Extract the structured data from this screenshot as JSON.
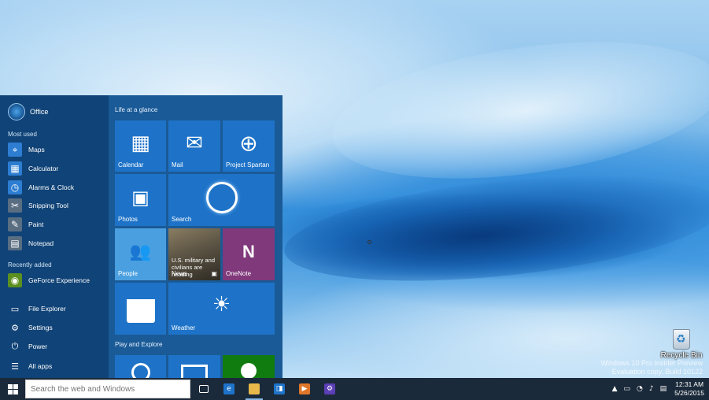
{
  "desktop": {
    "recycle_bin_label": "Recycle Bin",
    "watermark_line1": "Windows 10 Pro Insider Preview",
    "watermark_line2": "Evaluation copy. Build 10122"
  },
  "start_menu": {
    "user_name": "Office",
    "most_used_label": "Most used",
    "most_used": [
      {
        "label": "Maps",
        "icon": "maps-icon",
        "color": "#2d7dd2"
      },
      {
        "label": "Calculator",
        "icon": "calculator-icon",
        "color": "#2d7dd2"
      },
      {
        "label": "Alarms & Clock",
        "icon": "alarm-clock-icon",
        "color": "#2d7dd2"
      },
      {
        "label": "Snipping Tool",
        "icon": "scissors-icon",
        "color": "#5a6e82"
      },
      {
        "label": "Paint",
        "icon": "paint-palette-icon",
        "color": "#5a6e82"
      },
      {
        "label": "Notepad",
        "icon": "notepad-icon",
        "color": "#5a6e82"
      }
    ],
    "recently_added_label": "Recently added",
    "recently_added": [
      {
        "label": "GeForce Experience",
        "icon": "nvidia-icon",
        "color": "#5b8f1f"
      }
    ],
    "system": [
      {
        "label": "File Explorer",
        "icon": "folder-icon"
      },
      {
        "label": "Settings",
        "icon": "gear-icon"
      },
      {
        "label": "Power",
        "icon": "power-icon"
      },
      {
        "label": "All apps",
        "icon": "list-icon"
      }
    ],
    "groups": {
      "life_at_a_glance": "Life at a glance",
      "play_and_explore": "Play and Explore"
    },
    "tiles": {
      "calendar": "Calendar",
      "mail": "Mail",
      "project_spartan": "Project Spartan",
      "photos": "Photos",
      "search": "Search",
      "people": "People",
      "news": "News",
      "news_headline": "U.S. military and civilians are heading",
      "onenote": "OneNote",
      "store": "",
      "weather": "Weather"
    },
    "colors": {
      "tile_blue": "#1e73c8",
      "tile_light": "#4a9fe0",
      "onenote": "#80397b",
      "xbox": "#107c10"
    }
  },
  "taskbar": {
    "search_placeholder": "Search the web and Windows",
    "apps": [
      {
        "name": "task-view",
        "icon": "task-view-icon"
      },
      {
        "name": "ie",
        "icon": "internet-explorer-icon"
      },
      {
        "name": "file-explorer",
        "icon": "folder-icon"
      },
      {
        "name": "store",
        "icon": "store-icon"
      },
      {
        "name": "media",
        "icon": "media-player-icon"
      },
      {
        "name": "settings",
        "icon": "settings-app-icon"
      }
    ],
    "time": "12:31 AM",
    "date": "5/26/2015"
  }
}
